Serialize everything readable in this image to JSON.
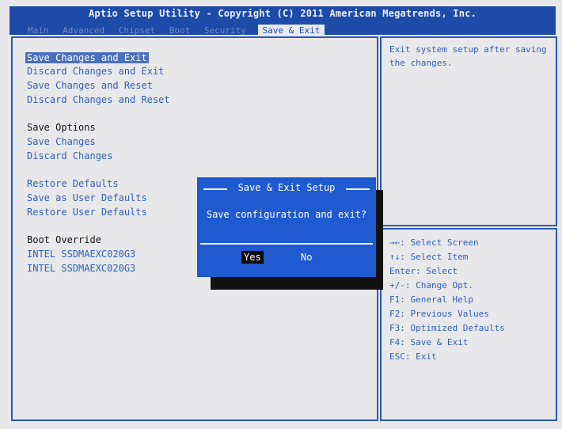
{
  "header": {
    "title": "Aptio Setup Utility - Copyright (C) 2011 American Megatrends, Inc.",
    "tabs": [
      "Main",
      "Advanced",
      "Chipset",
      "Boot",
      "Security",
      "Save & Exit"
    ],
    "active_tab": "Save & Exit"
  },
  "menu": {
    "items": [
      "Save Changes and Exit",
      "Discard Changes and Exit",
      "Save Changes and Reset",
      "Discard Changes and Reset",
      "Save Options",
      "Save Changes",
      "Discard Changes",
      "Restore Defaults",
      "Save as User Defaults",
      "Restore User Defaults",
      "Boot Override",
      "INTEL SSDMAEXC020G3",
      "INTEL SSDMAEXC020G3"
    ]
  },
  "help": {
    "description": "Exit system setup after saving the changes.",
    "keys": [
      "→←: Select Screen",
      "↑↓: Select Item",
      "Enter: Select",
      "+/-: Change Opt.",
      "F1: General Help",
      "F2: Previous Values",
      "F3: Optimized Defaults",
      "F4: Save & Exit",
      "ESC: Exit"
    ]
  },
  "dialog": {
    "title": "Save & Exit Setup",
    "message": "Save configuration and exit?",
    "yes_label": "Yes",
    "no_label": "No"
  },
  "colors": {
    "header_bg": "#1f4ba8",
    "panel_bg": "#e8e8ea",
    "accent": "#2a58b5",
    "dialog_bg": "#1f5ad0"
  }
}
